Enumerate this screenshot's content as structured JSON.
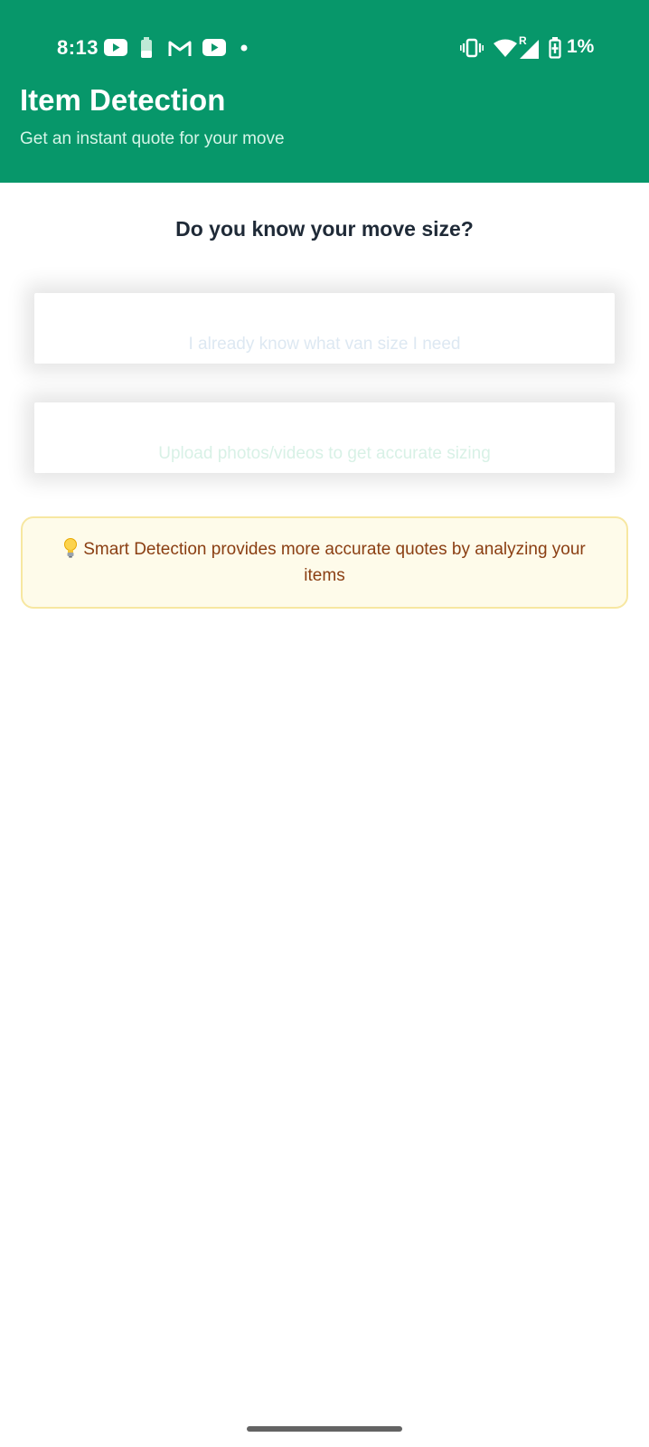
{
  "status_bar": {
    "time": "8:13",
    "battery_percent": "1%",
    "signal_roaming_label": "R",
    "left_icons": [
      "youtube-icon",
      "battery-saver-icon",
      "gmail-icon",
      "youtube-icon",
      "notification-dot-icon"
    ],
    "right_icons": [
      "vibrate-icon",
      "wifi-icon",
      "cellular-signal-icon",
      "battery-charging-icon"
    ]
  },
  "header": {
    "title": "Item Detection",
    "subtitle": "Get an instant quote for your move",
    "background_color": "#07976a"
  },
  "main": {
    "question": "Do you know your move size?",
    "options": [
      {
        "label": "I already know what van size I need"
      },
      {
        "label": "Upload photos/videos to get accurate sizing"
      }
    ],
    "info": {
      "icon": "lightbulb-icon",
      "text": "Smart Detection provides more accurate quotes by analyzing your items",
      "background_color": "#fefbea",
      "text_color": "#8a3e12"
    }
  }
}
